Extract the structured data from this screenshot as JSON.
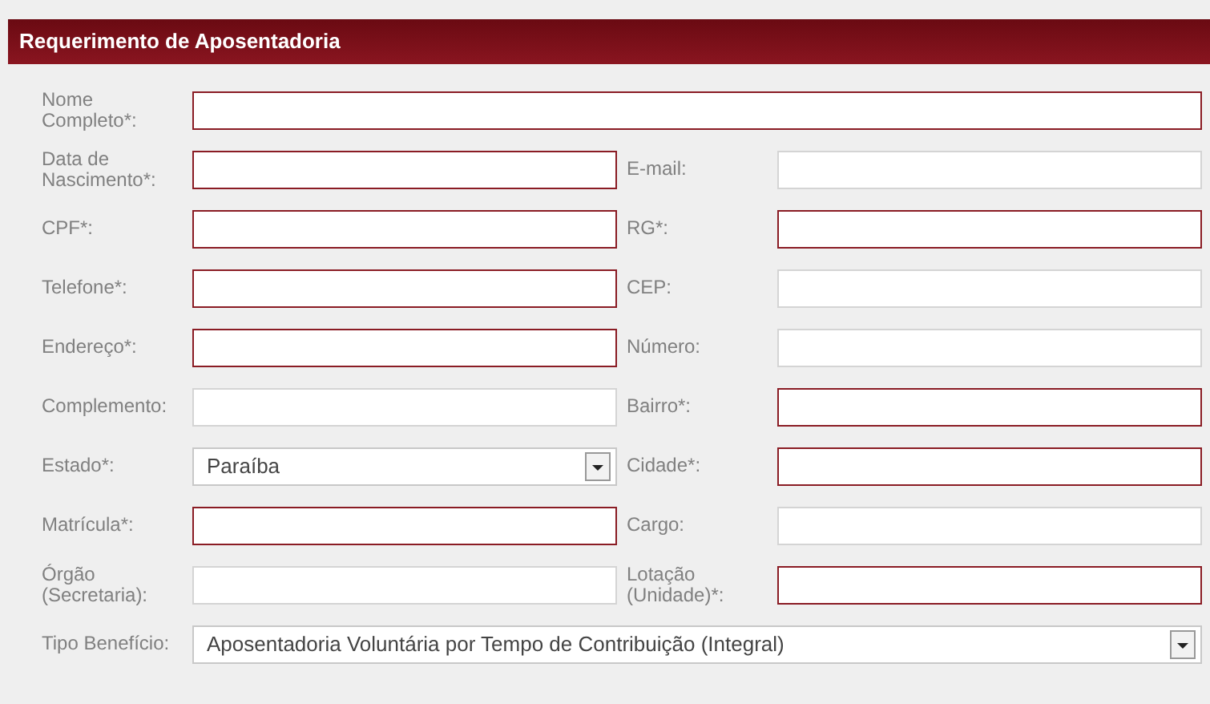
{
  "panel": {
    "title": "Requerimento de Aposentadoria"
  },
  "rows": [
    {
      "cells": [
        {
          "label": "Nome Completo*:",
          "kind": "text",
          "required": true
        }
      ]
    },
    {
      "cells": [
        {
          "label": "Data de Nascimento*:",
          "kind": "text",
          "required": true
        },
        {
          "label": "E-mail:",
          "kind": "text",
          "required": false
        }
      ]
    },
    {
      "cells": [
        {
          "label": "CPF*:",
          "kind": "text",
          "required": true
        },
        {
          "label": "RG*:",
          "kind": "text",
          "required": true
        }
      ]
    },
    {
      "cells": [
        {
          "label": "Telefone*:",
          "kind": "text",
          "required": true
        },
        {
          "label": "CEP:",
          "kind": "text",
          "required": false
        }
      ]
    },
    {
      "cells": [
        {
          "label": "Endereço*:",
          "kind": "text",
          "required": true
        },
        {
          "label": "Número:",
          "kind": "text",
          "required": false
        }
      ]
    },
    {
      "cells": [
        {
          "label": "Complemento:",
          "kind": "text",
          "required": false
        },
        {
          "label": "Bairro*:",
          "kind": "text",
          "required": true
        }
      ]
    },
    {
      "cells": [
        {
          "label": "Estado*:",
          "kind": "select",
          "value": "Paraíba"
        },
        {
          "label": "Cidade*:",
          "kind": "text",
          "required": true
        }
      ]
    },
    {
      "cells": [
        {
          "label": "Matrícula*:",
          "kind": "text",
          "required": true
        },
        {
          "label": "Cargo:",
          "kind": "text",
          "required": false
        }
      ]
    },
    {
      "cells": [
        {
          "label": "Órgão (Secretaria):",
          "kind": "text",
          "required": false
        },
        {
          "label": "Lotação (Unidade)*:",
          "kind": "text",
          "required": true
        }
      ]
    },
    {
      "cells": [
        {
          "label": "Tipo Benefício:",
          "kind": "select",
          "value": "Aposentadoria Voluntária por Tempo de Contribuição (Integral)"
        }
      ]
    }
  ]
}
